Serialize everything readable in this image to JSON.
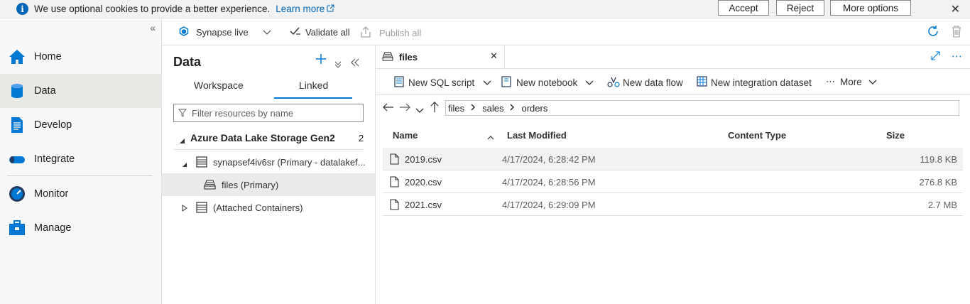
{
  "cookie_banner": {
    "message": "We use optional cookies to provide a better experience.",
    "learn_more": "Learn more",
    "accept": "Accept",
    "reject": "Reject",
    "more_options": "More options"
  },
  "nav": {
    "items": [
      {
        "label": "Home",
        "icon": "home-icon"
      },
      {
        "label": "Data",
        "icon": "database-icon"
      },
      {
        "label": "Develop",
        "icon": "document-icon"
      },
      {
        "label": "Integrate",
        "icon": "pipeline-icon"
      },
      {
        "label": "Monitor",
        "icon": "gauge-icon"
      },
      {
        "label": "Manage",
        "icon": "toolbox-icon"
      }
    ],
    "selected": "Data"
  },
  "toolbar": {
    "synapse_live": "Synapse live",
    "validate_all": "Validate all",
    "publish_all": "Publish all"
  },
  "data_panel": {
    "title": "Data",
    "tabs": [
      "Workspace",
      "Linked"
    ],
    "active_tab": "Linked",
    "filter_placeholder": "Filter resources by name",
    "section": {
      "title": "Azure Data Lake Storage Gen2",
      "count": "2"
    },
    "tree": {
      "storage": "synapsef4iv6sr (Primary - datalakef...",
      "container": "files (Primary)",
      "attached": "(Attached Containers)"
    }
  },
  "main": {
    "tab_label": "files",
    "commands": {
      "new_sql_script": "New SQL script",
      "new_notebook": "New notebook",
      "new_data_flow": "New data flow",
      "new_integration_dataset": "New integration dataset",
      "more": "More"
    },
    "breadcrumb": [
      "files",
      "sales",
      "orders"
    ],
    "columns": [
      "Name",
      "Last Modified",
      "Content Type",
      "Size"
    ],
    "files": [
      {
        "name": "2019.csv",
        "modified": "4/17/2024, 6:28:42 PM",
        "size": "119.8 KB"
      },
      {
        "name": "2020.csv",
        "modified": "4/17/2024, 6:28:56 PM",
        "size": "276.8 KB"
      },
      {
        "name": "2021.csv",
        "modified": "4/17/2024, 6:29:09 PM",
        "size": "2.7 MB"
      }
    ]
  },
  "colors": {
    "accent": "#0078d4",
    "nav_selected": "#ebe9e6",
    "row_selected": "#f3f2f1"
  }
}
